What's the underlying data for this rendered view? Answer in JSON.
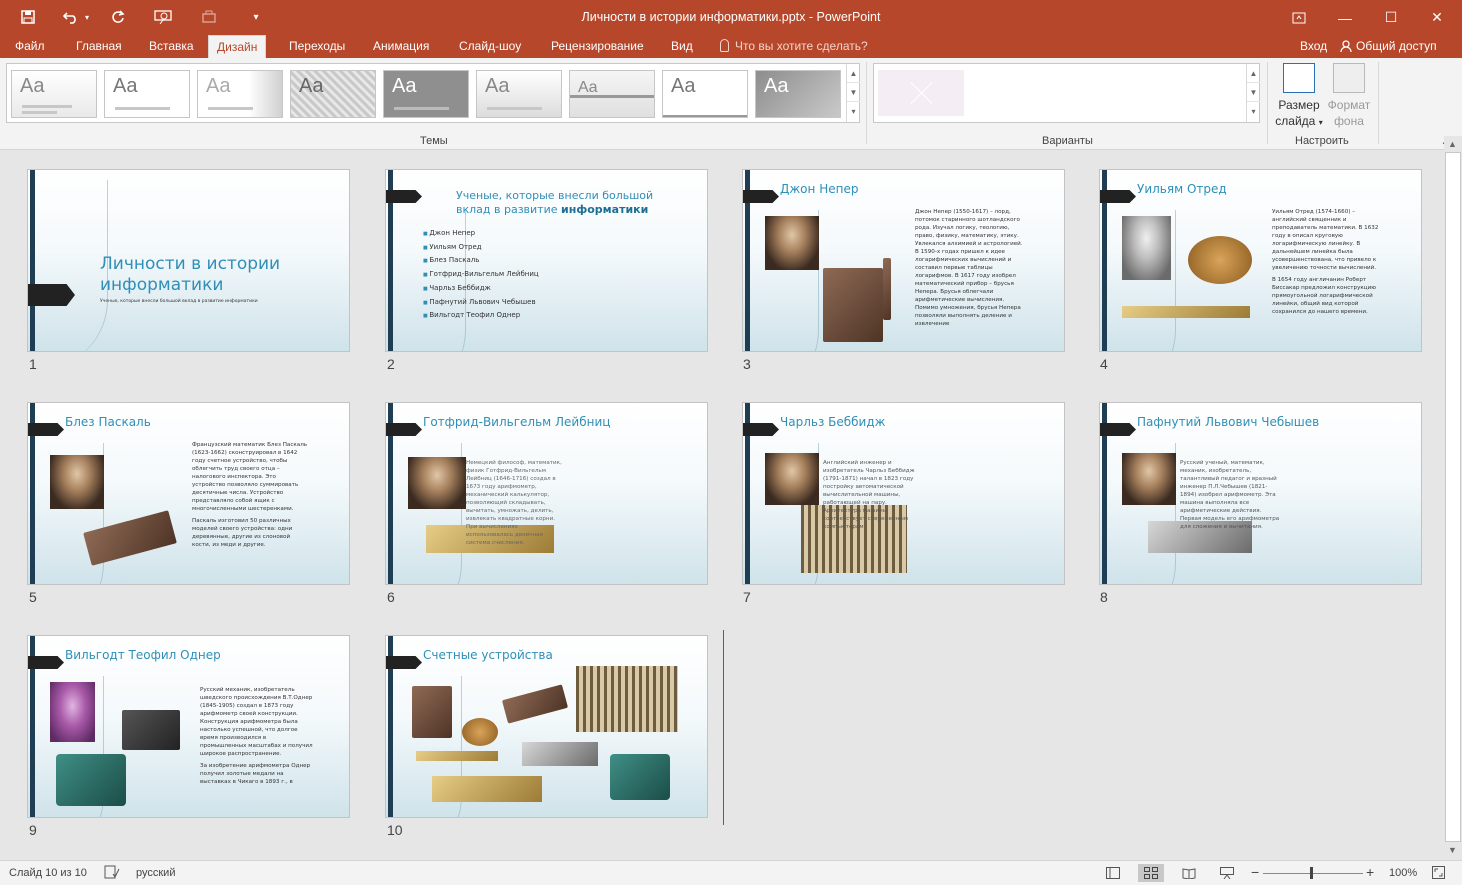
{
  "window": {
    "title": "Личности в истории информатики.pptx - PowerPoint",
    "minimize": "—",
    "maximize": "☐",
    "close": "✕"
  },
  "quick_access": {
    "save_icon": "save-icon",
    "undo_icon": "undo-icon",
    "redo_icon": "redo-icon"
  },
  "tabs": [
    "Файл",
    "Главная",
    "Вставка",
    "Дизайн",
    "Переходы",
    "Анимация",
    "Слайд-шоу",
    "Рецензирование",
    "Вид"
  ],
  "active_tab": "Дизайн",
  "tell_me": "Что вы хотите сделать?",
  "login": "Вход",
  "share": "Общий доступ",
  "ribbon": {
    "themes_label": "Темы",
    "variants_label": "Варианты",
    "customize_label": "Настроить",
    "theme_aa": "Aa",
    "slide_size_line1": "Размер",
    "slide_size_line2": "слайда",
    "format_bg_line1": "Формат",
    "format_bg_line2": "фона"
  },
  "slides": [
    {
      "num": "1",
      "title_line1": "Личности в истории",
      "title_line2": "информатики",
      "subtitle": "Ученые, которые внесли большой вклад в развитие информатики"
    },
    {
      "num": "2",
      "title_line1": "Ученые, которые внесли большой",
      "title_line2_a": "вклад в развитие ",
      "title_line2_b": "информатики",
      "items": [
        "Джон Непер",
        "Уильям Отред",
        "Блез Паскаль",
        "Готфрид-Вильгельм Лейбниц",
        "Чарльз Беббидж",
        "Пафнутий Львович Чебышев",
        "Вильгодт Теофил Однер"
      ]
    },
    {
      "num": "3",
      "title": "Джон Непер",
      "text": "Джон Непер (1550-1617) – лорд, потомок старинного шотландского рода. Изучал логику, теологию, право, физику, математику, этику. Увлекался алхимией и астрологией. В 1590-х годах пришел к идее логарифмических вычислений и составил первые таблицы логарифмов. В 1617 году изобрел математический прибор – брусья Непера. Брусья облегчали арифметические вычисления. Помимо умножения, брусья Непера позволяли выполнять деление и извлечение"
    },
    {
      "num": "4",
      "title": "Уильям Отред",
      "text1": "Уильям Отред (1574-1660) – английский священник и преподаватель математики. В 1632 году в описал круговую логарифмическую линейку. В дальнейшем линейка была усовершенствована, что привело к увеличению точности вычислений.",
      "text2": "В 1654 году англичанин Роберт Биссакар предложил конструкцию прямоугольной логарифмической линейки, общий вид которой сохранился до нашего времени."
    },
    {
      "num": "5",
      "title": "Блез Паскаль",
      "text1": "Французский математик Блез Паскаль (1623-1662) сконструировал в 1642 году счетное устройство, чтобы облегчить труд своего отца – налогового инспектора. Это устройство позволяло суммировать десятичные числа. Устройство представляло собой ящик с многочисленными шестеренками.",
      "text2": "Паскаль изготовил 50 различных моделей своего устройства: одни деревянные, другие из слоновой кости, из меди и другие."
    },
    {
      "num": "6",
      "title": "Готфрид-Вильгельм Лейбниц",
      "text": "Немецкий философ, математик, физик Готфрид-Вильгельм Лейбниц (1646-1716) создал в 1673 году арифмометр, механический калькулятор, позволяющий складывать, вычитать, умножать, делить, извлекать квадратные корни. При вычислениях использовалась двоичная система счисления."
    },
    {
      "num": "7",
      "title": "Чарльз Беббидж",
      "text": "Английский инженер и изобретатель Чарльз Беббидж (1791-1871) начал в 1823 году постройку автоматической вычислительной машины, работающей на пару. Архитектура машины соответствует современным компьютерам."
    },
    {
      "num": "8",
      "title": "Пафнутий Львович Чебышев",
      "text": "Русский ученый, математик, механик, изобретатель, талантливый педагог и вразный инженер П.Л.Чебышев (1821-1894) изобрел арифмометр. Эта машина выполняла все арифметические действия. Первая модель его арифмометра для сложения и вычитания."
    },
    {
      "num": "9",
      "title": "Вильгодт Теофил Однер",
      "text1": "Русский механик, изобретатель шведского происхождения В.Т.Однер (1845-1905) создал в 1873 году арифмометр своей конструкции. Конструкция арифмометра была настолько успешной, что долгое время производился в промышленных масштабах и получил широкое распространение.",
      "text2": "За изобретение арифмометра Однер получил золотые медали на выставках в Чикаго в 1893 г., в"
    },
    {
      "num": "10",
      "title": "Счетные устройства"
    }
  ],
  "status": {
    "slide_info": "Слайд 10 из 10",
    "language": "русский",
    "zoom": "100%",
    "zoom_minus": "−",
    "zoom_plus": "+"
  }
}
